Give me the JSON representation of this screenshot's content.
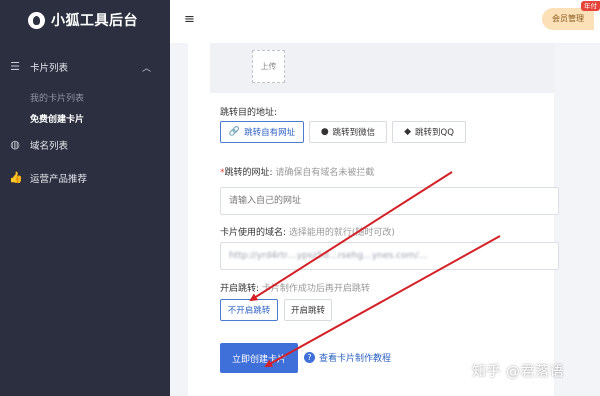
{
  "app": {
    "title": "小狐工具后台"
  },
  "sidebar": {
    "groups": [
      {
        "label": "卡片列表",
        "icon": "list-icon",
        "expanded": true,
        "items": [
          {
            "label": "我的卡片列表",
            "active": false
          },
          {
            "label": "免费创建卡片",
            "active": true
          }
        ]
      },
      {
        "label": "域名列表",
        "icon": "globe-icon"
      },
      {
        "label": "运营产品推荐",
        "icon": "thumbs-up-icon"
      }
    ]
  },
  "topbar": {
    "member_label": "会员管理",
    "badge": "年付"
  },
  "form": {
    "upload_label": "上传",
    "target_label": "跳转目的地址:",
    "targets": [
      {
        "label": "跳转自有网址",
        "icon": "link-icon",
        "selected": true
      },
      {
        "label": "跳转到微信",
        "icon": "wechat-icon",
        "selected": false
      },
      {
        "label": "跳转到QQ",
        "icon": "qq-icon",
        "selected": false
      }
    ],
    "url_label": "跳转的网址:",
    "url_hint": "请确保自有域名未被拦截",
    "url_placeholder": "请输入自己的网址",
    "domain_label": "卡片使用的域名:",
    "domain_hint": "选择能用的就行(随时可改)",
    "domain_value": "http://yrd4rtr…ypsz5d…rsehg…ynes.com/…",
    "redirect_label": "开启跳转:",
    "redirect_hint": "卡片制作成功后再开启跳转",
    "redirect_options": [
      {
        "label": "不开启跳转",
        "selected": true
      },
      {
        "label": "开启跳转",
        "selected": false
      }
    ],
    "submit_label": "立即创建卡片",
    "tutorial_label": "查看卡片制作教程"
  },
  "watermark": "知乎 @君落语",
  "colors": {
    "sidebar_bg": "#2b2f3f",
    "primary": "#3f6fd8",
    "arrow": "#d42027",
    "badge": "#e5443b"
  }
}
